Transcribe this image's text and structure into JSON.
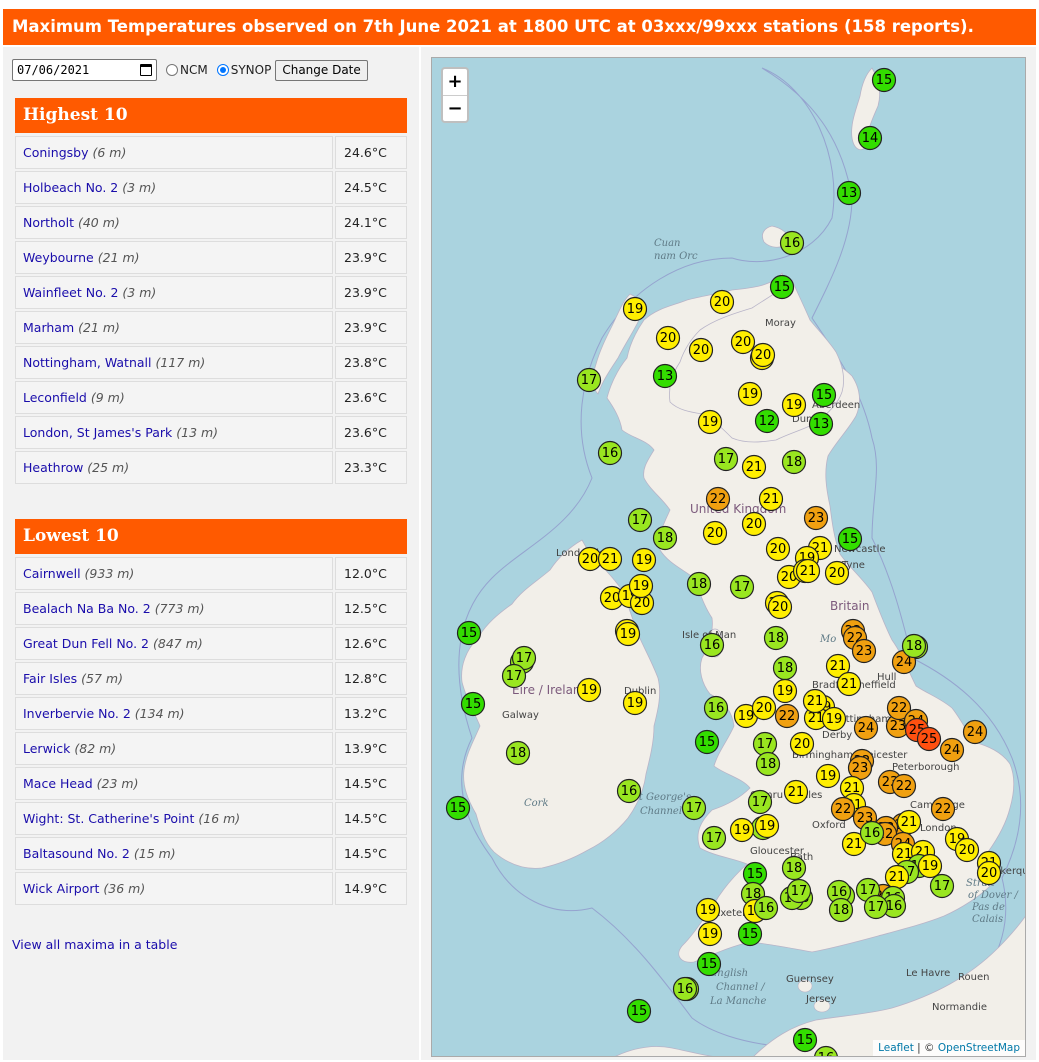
{
  "title": "Maximum Temperatures observed on 7th June 2021 at 1800 UTC at 03xxx/99xxx stations (158 reports).",
  "controls": {
    "date_value": "07/06/2021",
    "radio_ncm_label": "NCM",
    "radio_synop_label": "SYNOP",
    "selected": "SYNOP",
    "change_date_label": "Change Date"
  },
  "highest": {
    "heading": "Highest 10",
    "rows": [
      {
        "name": "Coningsby",
        "elev": "(6 m)",
        "value": "24.6°C"
      },
      {
        "name": "Holbeach No. 2",
        "elev": "(3 m)",
        "value": "24.5°C"
      },
      {
        "name": "Northolt",
        "elev": "(40 m)",
        "value": "24.1°C"
      },
      {
        "name": "Weybourne",
        "elev": "(21 m)",
        "value": "23.9°C"
      },
      {
        "name": "Wainfleet No. 2",
        "elev": "(3 m)",
        "value": "23.9°C"
      },
      {
        "name": "Marham",
        "elev": "(21 m)",
        "value": "23.9°C"
      },
      {
        "name": "Nottingham, Watnall",
        "elev": "(117 m)",
        "value": "23.8°C"
      },
      {
        "name": "Leconfield",
        "elev": "(9 m)",
        "value": "23.6°C"
      },
      {
        "name": "London, St James's Park",
        "elev": "(13 m)",
        "value": "23.6°C"
      },
      {
        "name": "Heathrow",
        "elev": "(25 m)",
        "value": "23.3°C"
      }
    ]
  },
  "lowest": {
    "heading": "Lowest 10",
    "rows": [
      {
        "name": "Cairnwell",
        "elev": "(933 m)",
        "value": "12.0°C"
      },
      {
        "name": "Bealach Na Ba No. 2",
        "elev": "(773 m)",
        "value": "12.5°C"
      },
      {
        "name": "Great Dun Fell No. 2",
        "elev": "(847 m)",
        "value": "12.6°C"
      },
      {
        "name": "Fair Isles",
        "elev": "(57 m)",
        "value": "12.8°C"
      },
      {
        "name": "Inverbervie No. 2",
        "elev": "(134 m)",
        "value": "13.2°C"
      },
      {
        "name": "Lerwick",
        "elev": "(82 m)",
        "value": "13.9°C"
      },
      {
        "name": "Mace Head",
        "elev": "(23 m)",
        "value": "14.5°C"
      },
      {
        "name": "Wight: St. Catherine's Point",
        "elev": "(16 m)",
        "value": "14.5°C"
      },
      {
        "name": "Baltasound No. 2",
        "elev": "(15 m)",
        "value": "14.5°C"
      },
      {
        "name": "Wick Airport",
        "elev": "(36 m)",
        "value": "14.9°C"
      }
    ]
  },
  "view_all_label": "View all maxima in a table",
  "map": {
    "zoom_in": "+",
    "zoom_out": "−",
    "attribution_leaflet": "Leaflet",
    "attribution_sep": " | © ",
    "attribution_osm": "OpenStreetMap",
    "colors": {
      "sea": "#aad3df",
      "land": "#f2efe9",
      "green": "#33dd00",
      "lightgreen": "#99e620",
      "yellow": "#ffee00",
      "orange": "#f0a010",
      "red": "#ff5010"
    },
    "place_labels": [
      {
        "text": "Moray"
      },
      {
        "text": "Aberdeen"
      },
      {
        "text": "Dundee"
      },
      {
        "text": "United Kingdom"
      },
      {
        "text": "Newcastle"
      },
      {
        "text": "Tyne"
      },
      {
        "text": "Britain"
      },
      {
        "text": "Isle of Man"
      },
      {
        "text": "Eire / Ireland"
      },
      {
        "text": "Galway"
      },
      {
        "text": "Hull"
      },
      {
        "text": "Sheffield"
      },
      {
        "text": "Nottingham"
      },
      {
        "text": "Birmingham"
      },
      {
        "text": "Peterborough"
      },
      {
        "text": "Cambridge"
      },
      {
        "text": "Cardiff"
      },
      {
        "text": "Gloucester"
      },
      {
        "text": "Bath"
      },
      {
        "text": "Oxford"
      },
      {
        "text": "London"
      },
      {
        "text": "Cymru / Wales"
      },
      {
        "text": "Londonderry"
      },
      {
        "text": "Dublin"
      },
      {
        "text": "Exeter"
      },
      {
        "text": "Guernsey"
      },
      {
        "text": "Jersey"
      },
      {
        "text": "Le Havre"
      },
      {
        "text": "Rouen"
      },
      {
        "text": "Normandie"
      },
      {
        "text": "Dunkerque"
      },
      {
        "text": "Bradford"
      },
      {
        "text": "Derby"
      },
      {
        "text": "Leicester"
      }
    ],
    "sea_labels": [
      {
        "text": "Cuan"
      },
      {
        "text": "nam Orc"
      },
      {
        "text": "St George's"
      },
      {
        "text": "Channel"
      },
      {
        "text": "English"
      },
      {
        "text": "Channel /"
      },
      {
        "text": "La Manche"
      },
      {
        "text": "Strait"
      },
      {
        "text": "of Dover /"
      },
      {
        "text": "Pas de"
      },
      {
        "text": "Calais"
      },
      {
        "text": "Mo"
      },
      {
        "text": "Cork"
      }
    ],
    "observations": [
      {
        "v": 15,
        "c": "green"
      },
      {
        "v": 14,
        "c": "green"
      },
      {
        "v": 13,
        "c": "green"
      },
      {
        "v": 16,
        "c": "lightgreen"
      },
      {
        "v": 15,
        "c": "green"
      },
      {
        "v": 19,
        "c": "yellow"
      },
      {
        "v": 20,
        "c": "yellow"
      },
      {
        "v": 20,
        "c": "yellow"
      },
      {
        "v": 20,
        "c": "yellow"
      },
      {
        "v": 20,
        "c": "yellow"
      },
      {
        "v": 19,
        "c": "yellow"
      },
      {
        "v": 20,
        "c": "yellow"
      },
      {
        "v": 17,
        "c": "lightgreen"
      },
      {
        "v": 13,
        "c": "green"
      },
      {
        "v": 19,
        "c": "yellow"
      },
      {
        "v": 19,
        "c": "yellow"
      },
      {
        "v": 15,
        "c": "green"
      },
      {
        "v": 12,
        "c": "green"
      },
      {
        "v": 13,
        "c": "green"
      },
      {
        "v": 19,
        "c": "yellow"
      },
      {
        "v": 16,
        "c": "lightgreen"
      },
      {
        "v": 17,
        "c": "lightgreen"
      },
      {
        "v": 21,
        "c": "yellow"
      },
      {
        "v": 18,
        "c": "lightgreen"
      },
      {
        "v": 22,
        "c": "orange"
      },
      {
        "v": 21,
        "c": "yellow"
      },
      {
        "v": 20,
        "c": "yellow"
      },
      {
        "v": 20,
        "c": "yellow"
      },
      {
        "v": 23,
        "c": "orange"
      },
      {
        "v": 17,
        "c": "lightgreen"
      },
      {
        "v": 18,
        "c": "lightgreen"
      },
      {
        "v": 15,
        "c": "green"
      },
      {
        "v": 20,
        "c": "yellow"
      },
      {
        "v": 21,
        "c": "yellow"
      },
      {
        "v": 19,
        "c": "yellow"
      },
      {
        "v": 20,
        "c": "yellow"
      },
      {
        "v": 20,
        "c": "yellow"
      },
      {
        "v": 21,
        "c": "yellow"
      },
      {
        "v": 20,
        "c": "yellow"
      },
      {
        "v": 18,
        "c": "lightgreen"
      },
      {
        "v": 17,
        "c": "lightgreen"
      },
      {
        "v": 20,
        "c": "yellow"
      },
      {
        "v": 19,
        "c": "yellow"
      },
      {
        "v": 20,
        "c": "yellow"
      },
      {
        "v": 19,
        "c": "yellow"
      },
      {
        "v": 20,
        "c": "yellow"
      },
      {
        "v": 17,
        "c": "lightgreen"
      },
      {
        "v": 21,
        "c": "yellow"
      },
      {
        "v": 19,
        "c": "yellow"
      },
      {
        "v": 19,
        "c": "yellow"
      },
      {
        "v": 21,
        "c": "yellow"
      },
      {
        "v": 20,
        "c": "yellow"
      },
      {
        "v": 22,
        "c": "orange"
      },
      {
        "v": 22,
        "c": "orange"
      },
      {
        "v": 23,
        "c": "orange"
      },
      {
        "v": 18,
        "c": "lightgreen"
      },
      {
        "v": 24,
        "c": "orange"
      },
      {
        "v": 15,
        "c": "green"
      },
      {
        "v": 17,
        "c": "lightgreen"
      },
      {
        "v": 17,
        "c": "lightgreen"
      },
      {
        "v": 19,
        "c": "yellow"
      },
      {
        "v": 16,
        "c": "lightgreen"
      },
      {
        "v": 18,
        "c": "lightgreen"
      },
      {
        "v": 18,
        "c": "lightgreen"
      },
      {
        "v": 21,
        "c": "yellow"
      },
      {
        "v": 21,
        "c": "yellow"
      },
      {
        "v": 19,
        "c": "yellow"
      },
      {
        "v": 19,
        "c": "yellow"
      },
      {
        "v": 21,
        "c": "yellow"
      },
      {
        "v": 15,
        "c": "green"
      },
      {
        "v": 19,
        "c": "yellow"
      },
      {
        "v": 19,
        "c": "yellow"
      },
      {
        "v": 15,
        "c": "green"
      },
      {
        "v": 18,
        "c": "lightgreen"
      },
      {
        "v": 16,
        "c": "lightgreen"
      },
      {
        "v": 15,
        "c": "green"
      },
      {
        "v": 17,
        "c": "lightgreen"
      },
      {
        "v": 16,
        "c": "lightgreen"
      },
      {
        "v": 19,
        "c": "yellow"
      },
      {
        "v": 20,
        "c": "yellow"
      },
      {
        "v": 22,
        "c": "orange"
      },
      {
        "v": 21,
        "c": "yellow"
      },
      {
        "v": 19,
        "c": "yellow"
      },
      {
        "v": 24,
        "c": "orange"
      },
      {
        "v": 23,
        "c": "orange"
      },
      {
        "v": 22,
        "c": "orange"
      },
      {
        "v": 24,
        "c": "orange"
      },
      {
        "v": 25,
        "c": "red"
      },
      {
        "v": 25,
        "c": "red"
      },
      {
        "v": 24,
        "c": "orange"
      },
      {
        "v": 24,
        "c": "orange"
      },
      {
        "v": 18,
        "c": "lightgreen"
      },
      {
        "v": 17,
        "c": "lightgreen"
      },
      {
        "v": 20,
        "c": "yellow"
      },
      {
        "v": 22,
        "c": "orange"
      },
      {
        "v": 23,
        "c": "orange"
      },
      {
        "v": 23,
        "c": "orange"
      },
      {
        "v": 22,
        "c": "orange"
      },
      {
        "v": 19,
        "c": "yellow"
      },
      {
        "v": 21,
        "c": "yellow"
      },
      {
        "v": 21,
        "c": "yellow"
      },
      {
        "v": 21,
        "c": "yellow"
      },
      {
        "v": 23,
        "c": "orange"
      },
      {
        "v": 22,
        "c": "orange"
      },
      {
        "v": 22,
        "c": "orange"
      },
      {
        "v": 18,
        "c": "lightgreen"
      },
      {
        "v": 17,
        "c": "lightgreen"
      },
      {
        "v": 16,
        "c": "lightgreen"
      },
      {
        "v": 17,
        "c": "lightgreen"
      },
      {
        "v": 19,
        "c": "yellow"
      },
      {
        "v": 19,
        "c": "yellow"
      },
      {
        "v": 22,
        "c": "orange"
      },
      {
        "v": 21,
        "c": "yellow"
      },
      {
        "v": 21,
        "c": "yellow"
      },
      {
        "v": 23,
        "c": "orange"
      },
      {
        "v": 22,
        "c": "orange"
      },
      {
        "v": 24,
        "c": "orange"
      },
      {
        "v": 21,
        "c": "yellow"
      },
      {
        "v": 21,
        "c": "yellow"
      },
      {
        "v": 18,
        "c": "lightgreen"
      },
      {
        "v": 17,
        "c": "lightgreen"
      },
      {
        "v": 16,
        "c": "lightgreen"
      },
      {
        "v": 19,
        "c": "yellow"
      },
      {
        "v": 19,
        "c": "yellow"
      },
      {
        "v": 20,
        "c": "yellow"
      },
      {
        "v": 21,
        "c": "yellow"
      },
      {
        "v": 21,
        "c": "yellow"
      },
      {
        "v": 20,
        "c": "yellow"
      },
      {
        "v": 17,
        "c": "lightgreen"
      },
      {
        "v": 17,
        "c": "lightgreen"
      },
      {
        "v": 22,
        "c": "orange"
      },
      {
        "v": 18,
        "c": "lightgreen"
      },
      {
        "v": 15,
        "c": "green"
      },
      {
        "v": 16,
        "c": "lightgreen"
      },
      {
        "v": 18,
        "c": "lightgreen"
      },
      {
        "v": 18,
        "c": "lightgreen"
      },
      {
        "v": 17,
        "c": "lightgreen"
      },
      {
        "v": 16,
        "c": "lightgreen"
      },
      {
        "v": 16,
        "c": "lightgreen"
      },
      {
        "v": 16,
        "c": "lightgreen"
      },
      {
        "v": 19,
        "c": "yellow"
      },
      {
        "v": 15,
        "c": "green"
      },
      {
        "v": 17,
        "c": "lightgreen"
      },
      {
        "v": 17,
        "c": "lightgreen"
      },
      {
        "v": 15,
        "c": "green"
      },
      {
        "v": 18,
        "c": "lightgreen"
      },
      {
        "v": 16,
        "c": "lightgreen"
      },
      {
        "v": 15,
        "c": "green"
      },
      {
        "v": 15,
        "c": "green"
      },
      {
        "v": 16,
        "c": "lightgreen"
      },
      {
        "v": 19,
        "c": "yellow"
      },
      {
        "v": 18,
        "c": "lightgreen"
      },
      {
        "v": 16,
        "c": "lightgreen"
      },
      {
        "v": 19,
        "c": "yellow"
      }
    ]
  }
}
